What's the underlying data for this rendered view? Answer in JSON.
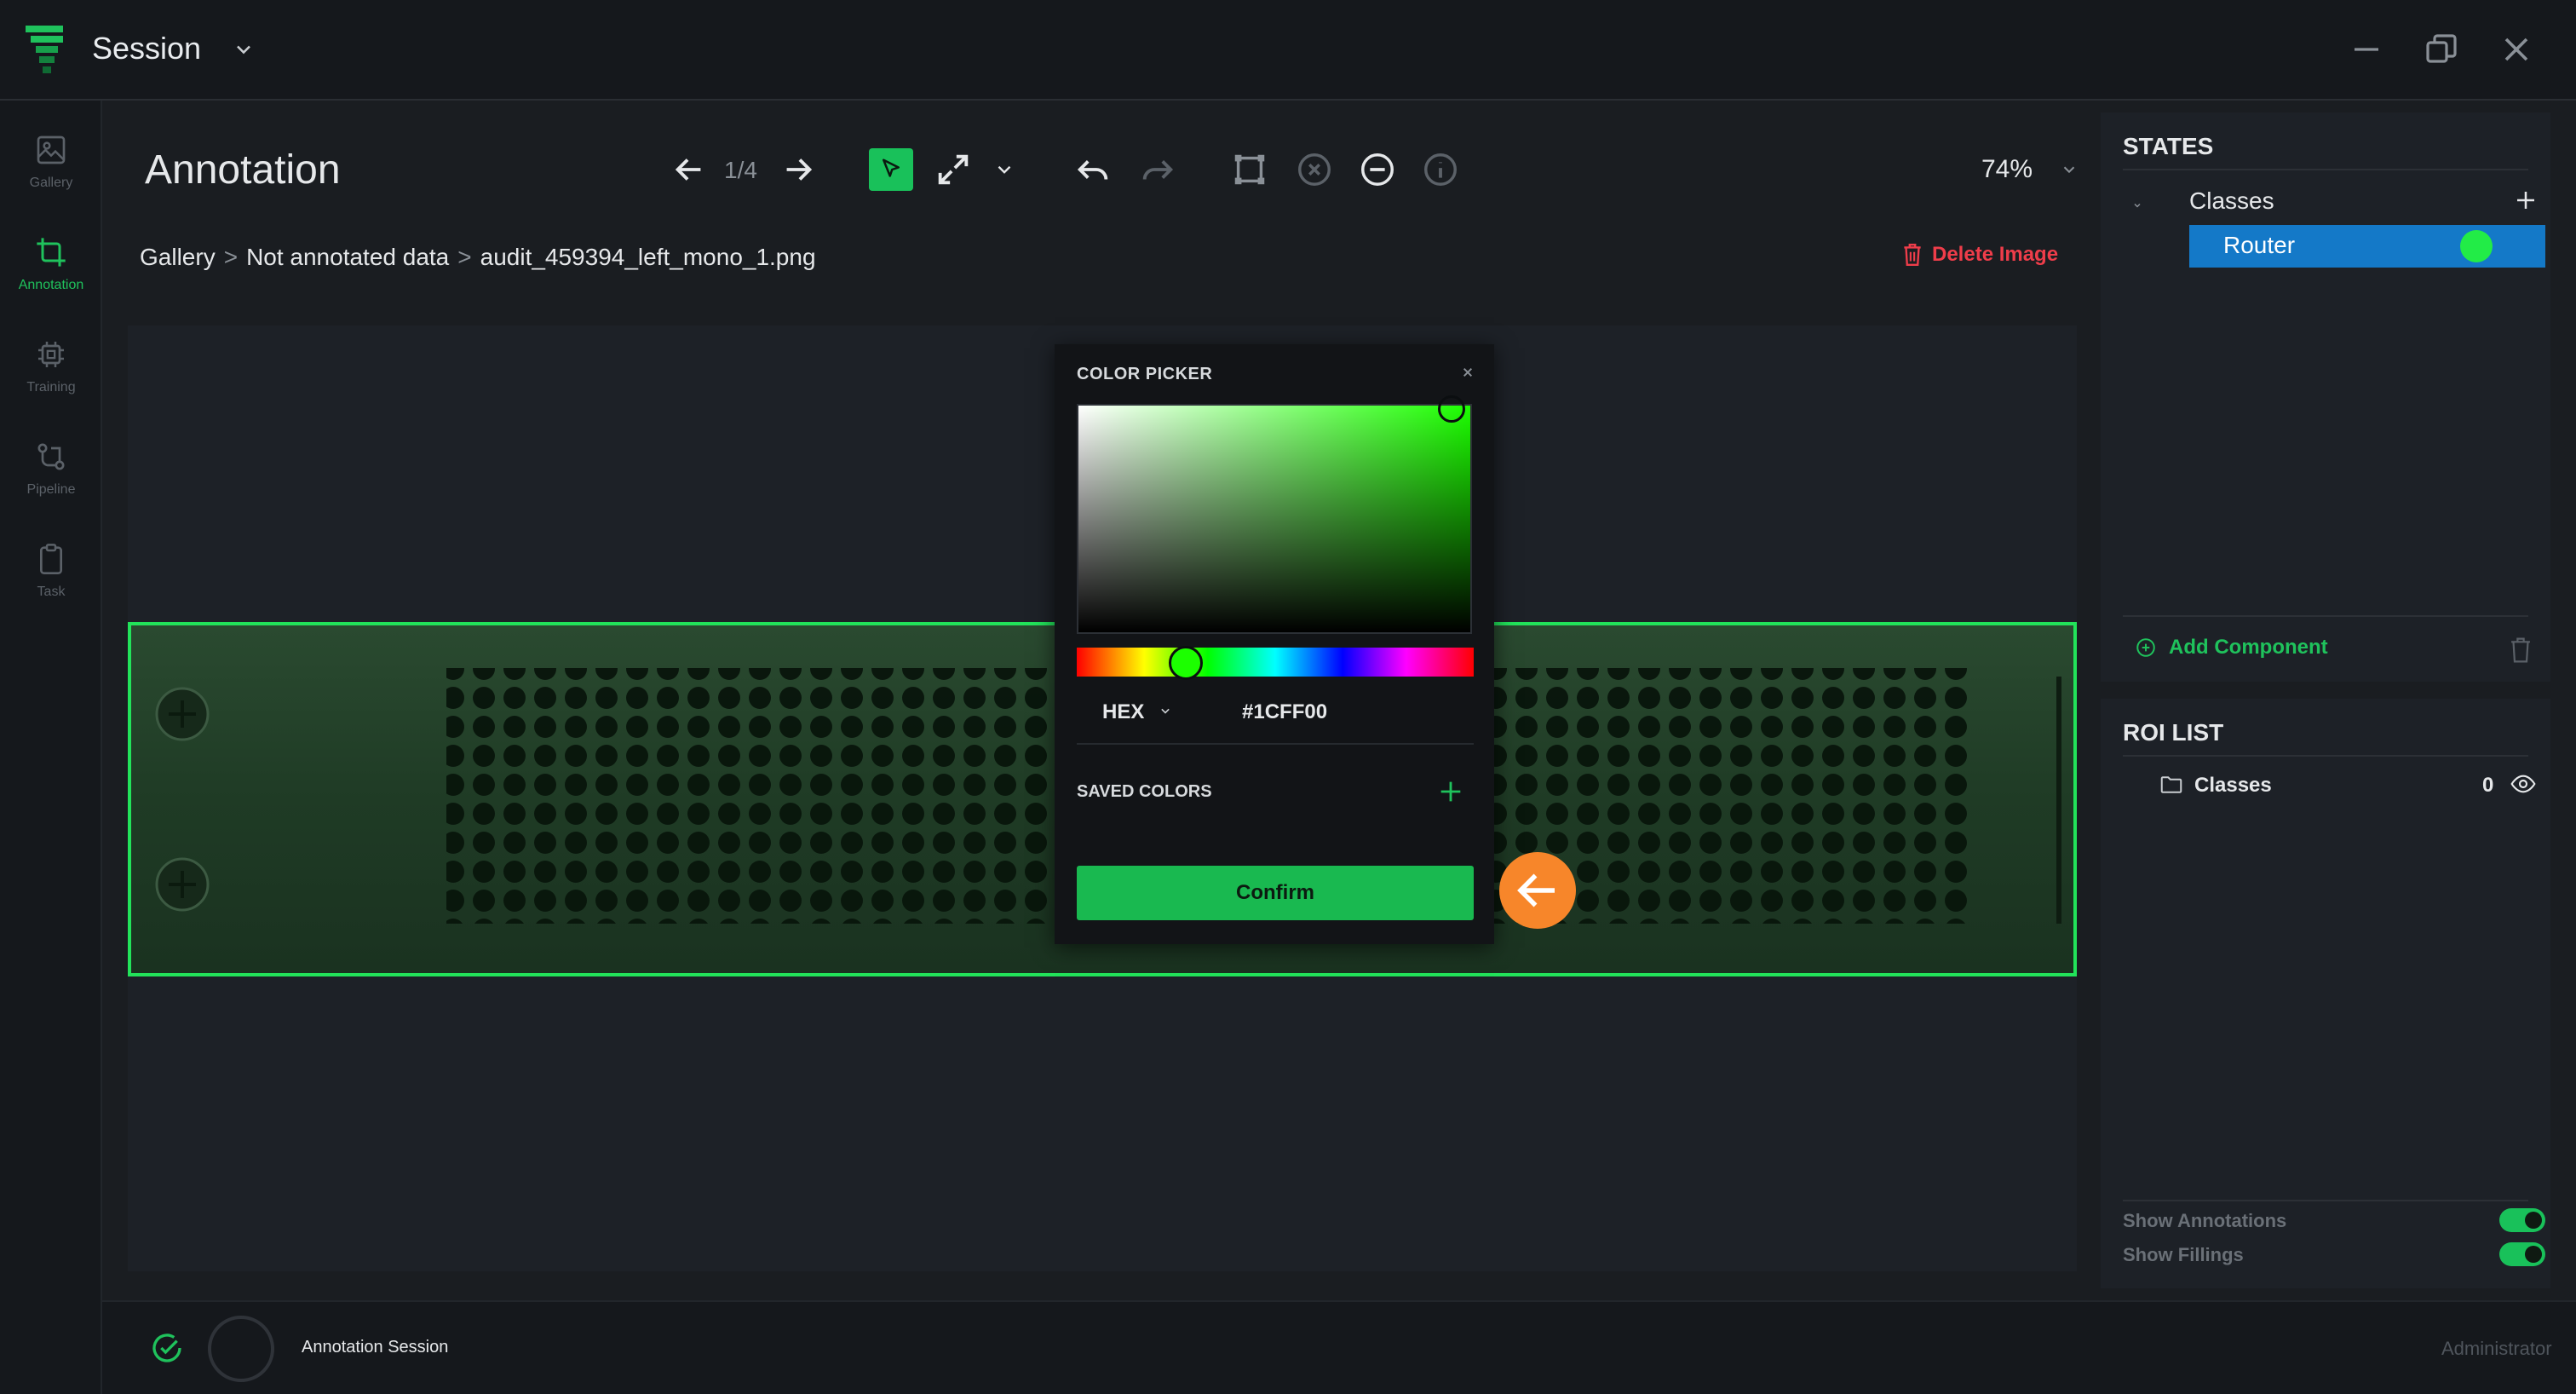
{
  "app": {
    "session_title": "Session"
  },
  "nav": {
    "items": [
      {
        "label": "Gallery",
        "icon": "image-icon",
        "active": false
      },
      {
        "label": "Annotation",
        "icon": "crop-icon",
        "active": true
      },
      {
        "label": "Training",
        "icon": "chip-icon",
        "active": false
      },
      {
        "label": "Pipeline",
        "icon": "pipeline-icon",
        "active": false
      },
      {
        "label": "Task",
        "icon": "clipboard-icon",
        "active": false
      }
    ]
  },
  "toolbar": {
    "title": "Annotation",
    "counter": "1/4",
    "zoom": "74%"
  },
  "breadcrumb": {
    "items": [
      "Gallery",
      "Not annotated data",
      "audit_459394_left_mono_1.png"
    ],
    "separator": ">"
  },
  "actions": {
    "delete_image": "Delete Image"
  },
  "color_picker": {
    "title": "COLOR PICKER",
    "format": "HEX",
    "hex_value": "#1CFF00",
    "saved_colors_label": "SAVED COLORS",
    "confirm_label": "Confirm"
  },
  "states": {
    "title": "STATES",
    "group_label": "Classes",
    "selected_class": "Router",
    "selected_class_color": "#22ec47",
    "add_component_label": "Add Component"
  },
  "roi_list": {
    "title": "ROI LIST",
    "group_label": "Classes",
    "count": "0",
    "show_annotations_label": "Show Annotations",
    "show_annotations_on": true,
    "show_fillings_label": "Show Fillings",
    "show_fillings_on": true
  },
  "status_bar": {
    "session_status": "Annotation Session",
    "user_role": "Administrator"
  },
  "colors": {
    "accent_green": "#19c15a",
    "selection_blue": "#1479c8",
    "danger_red": "#ef3d4a",
    "cursor_orange": "#f7862a"
  }
}
